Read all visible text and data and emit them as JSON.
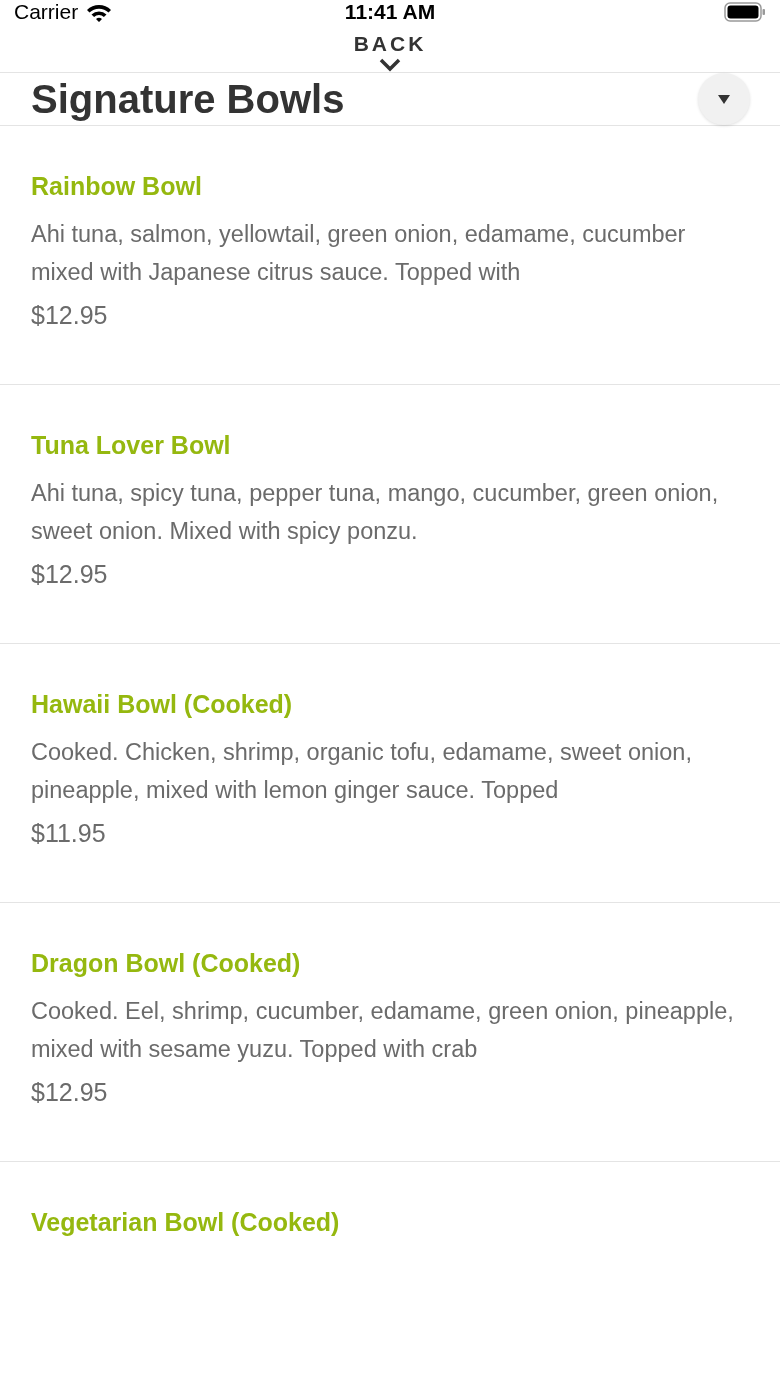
{
  "status_bar": {
    "carrier": "Carrier",
    "time": "11:41 AM"
  },
  "nav": {
    "back": "BACK"
  },
  "section": {
    "title": "Signature Bowls",
    "expanded": true
  },
  "items": [
    {
      "name": "Rainbow Bowl",
      "description": "Ahi tuna, salmon, yellowtail, green onion, edamame, cucumber mixed with Japanese citrus sauce. Topped with",
      "price": "$12.95"
    },
    {
      "name": "Tuna Lover Bowl",
      "description": "Ahi tuna, spicy tuna, pepper tuna, mango, cucumber, green onion, sweet onion. Mixed with spicy ponzu.",
      "price": "$12.95"
    },
    {
      "name": "Hawaii Bowl (Cooked)",
      "description": "Cooked. Chicken, shrimp, organic tofu, edamame, sweet onion, pineapple, mixed with lemon ginger sauce. Topped",
      "price": "$11.95"
    },
    {
      "name": "Dragon Bowl (Cooked)",
      "description": "Cooked. Eel, shrimp, cucumber, edamame, green onion, pineapple, mixed with sesame yuzu. Topped with crab",
      "price": "$12.95"
    },
    {
      "name": "Vegetarian Bowl (Cooked)"
    }
  ]
}
